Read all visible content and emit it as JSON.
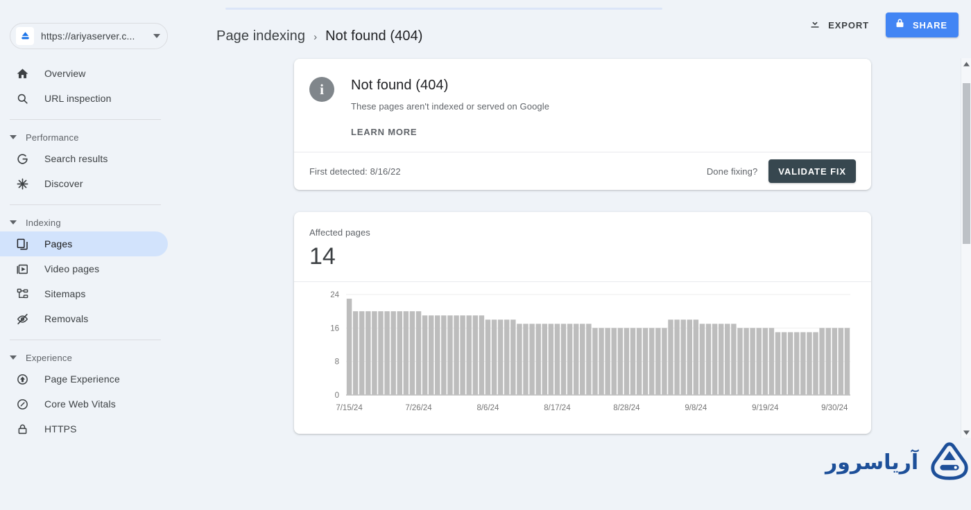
{
  "property": {
    "url": "https://ariyaserver.c...",
    "icon": "server-property-icon",
    "caret_icon": "chevron-down-icon"
  },
  "sidebar": {
    "items": [
      {
        "type": "item",
        "label": "Overview",
        "icon": "home-icon",
        "selected": false
      },
      {
        "type": "item",
        "label": "URL inspection",
        "icon": "search-icon",
        "selected": false
      },
      {
        "type": "separator"
      },
      {
        "type": "group",
        "label": "Performance",
        "icon": "caret-down-icon"
      },
      {
        "type": "item",
        "label": "Search results",
        "icon": "google-g-icon",
        "selected": false
      },
      {
        "type": "item",
        "label": "Discover",
        "icon": "asterisk-icon",
        "selected": false
      },
      {
        "type": "separator"
      },
      {
        "type": "group",
        "label": "Indexing",
        "icon": "caret-down-icon"
      },
      {
        "type": "item",
        "label": "Pages",
        "icon": "pages-icon",
        "selected": true
      },
      {
        "type": "item",
        "label": "Video pages",
        "icon": "video-pages-icon",
        "selected": false
      },
      {
        "type": "item",
        "label": "Sitemaps",
        "icon": "sitemap-icon",
        "selected": false
      },
      {
        "type": "item",
        "label": "Removals",
        "icon": "eye-off-icon",
        "selected": false
      },
      {
        "type": "separator"
      },
      {
        "type": "group",
        "label": "Experience",
        "icon": "caret-down-icon"
      },
      {
        "type": "item",
        "label": "Page Experience",
        "icon": "page-experience-icon",
        "selected": false
      },
      {
        "type": "item",
        "label": "Core Web Vitals",
        "icon": "gauge-icon",
        "selected": false
      },
      {
        "type": "item",
        "label": "HTTPS",
        "icon": "lock-icon",
        "selected": false
      }
    ]
  },
  "header": {
    "breadcrumb": {
      "parent": "Page indexing",
      "separator": "›",
      "current": "Not found (404)"
    },
    "export_label": "EXPORT",
    "export_icon": "download-icon",
    "share_label": "SHARE",
    "share_icon": "lock-icon",
    "share_color": "#4285f4"
  },
  "summary_card": {
    "status_icon": "info-icon",
    "title": "Not found (404)",
    "subtitle": "These pages aren't indexed or served on Google",
    "learn_more": "LEARN MORE",
    "first_detected": "First detected: 8/16/22",
    "done_fixing": "Done fixing?",
    "validate_fix": "VALIDATE FIX",
    "validate_fix_color": "#37474f"
  },
  "chart_card": {
    "label": "Affected pages",
    "value": "14"
  },
  "chart_data": {
    "type": "bar",
    "title": "Affected pages",
    "xlabel": "",
    "ylabel": "",
    "ylim": [
      0,
      24
    ],
    "yticks": [
      0,
      8,
      16,
      24
    ],
    "ytick_labels": [
      "0",
      "8",
      "16",
      "24"
    ],
    "grid": true,
    "legend": null,
    "bar_color": "#bdbdbd",
    "axis_color": "#757575",
    "tick_label_color": "#757575",
    "xtick_labels": [
      "7/15/24",
      "7/26/24",
      "8/6/24",
      "8/17/24",
      "8/28/24",
      "9/8/24",
      "9/19/24",
      "9/30/24"
    ],
    "xtick_indices": [
      0,
      11,
      22,
      33,
      44,
      55,
      66,
      77
    ],
    "x": [
      "7/15/24",
      "7/16/24",
      "7/17/24",
      "7/18/24",
      "7/19/24",
      "7/20/24",
      "7/21/24",
      "7/22/24",
      "7/23/24",
      "7/24/24",
      "7/25/24",
      "7/26/24",
      "7/27/24",
      "7/28/24",
      "7/29/24",
      "7/30/24",
      "7/31/24",
      "8/1/24",
      "8/2/24",
      "8/3/24",
      "8/4/24",
      "8/5/24",
      "8/6/24",
      "8/7/24",
      "8/8/24",
      "8/9/24",
      "8/10/24",
      "8/11/24",
      "8/12/24",
      "8/13/24",
      "8/14/24",
      "8/15/24",
      "8/16/24",
      "8/17/24",
      "8/18/24",
      "8/19/24",
      "8/20/24",
      "8/21/24",
      "8/22/24",
      "8/23/24",
      "8/24/24",
      "8/25/24",
      "8/26/24",
      "8/27/24",
      "8/28/24",
      "8/29/24",
      "8/30/24",
      "8/31/24",
      "9/1/24",
      "9/2/24",
      "9/3/24",
      "9/4/24",
      "9/5/24",
      "9/6/24",
      "9/7/24",
      "9/8/24",
      "9/9/24",
      "9/10/24",
      "9/11/24",
      "9/12/24",
      "9/13/24",
      "9/14/24",
      "9/15/24",
      "9/16/24",
      "9/17/24",
      "9/18/24",
      "9/19/24",
      "9/20/24",
      "9/21/24",
      "9/22/24",
      "9/23/24",
      "9/24/24",
      "9/25/24",
      "9/26/24",
      "9/27/24",
      "9/28/24",
      "9/29/24",
      "9/30/24",
      "10/1/24",
      "10/2/24"
    ],
    "values": [
      23,
      20,
      20,
      20,
      20,
      20,
      20,
      20,
      20,
      20,
      20,
      20,
      19,
      19,
      19,
      19,
      19,
      19,
      19,
      19,
      19,
      19,
      18,
      18,
      18,
      18,
      18,
      17,
      17,
      17,
      17,
      17,
      17,
      17,
      17,
      17,
      17,
      17,
      17,
      16,
      16,
      16,
      16,
      16,
      16,
      16,
      16,
      16,
      16,
      16,
      16,
      18,
      18,
      18,
      18,
      18,
      17,
      17,
      17,
      17,
      17,
      17,
      16,
      16,
      16,
      16,
      16,
      16,
      15,
      15,
      15,
      15,
      15,
      15,
      15,
      16,
      16,
      16,
      16,
      16
    ]
  },
  "scrollbar": {
    "up_icon": "scroll-up-arrow-icon",
    "down_icon": "scroll-down-arrow-icon"
  },
  "watermark": {
    "text": "آریاسرور",
    "icon": "ariaserver-logo-icon",
    "color": "#1d4f99"
  }
}
